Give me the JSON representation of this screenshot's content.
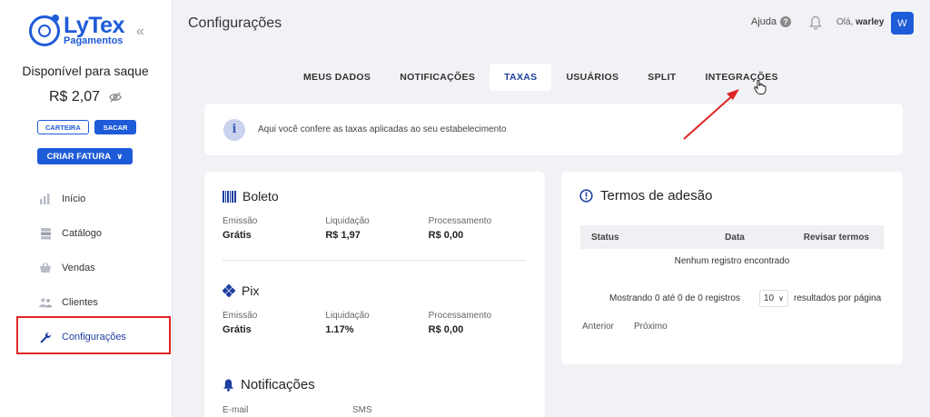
{
  "brand": {
    "name": "LyTex",
    "sub": "Pagamentos",
    "color": "#1e5bd8"
  },
  "sidebar": {
    "balance_label": "Disponível para saque",
    "balance_value": "R$ 2,07",
    "wallet_label": "CARTEIRA",
    "withdraw_label": "SACAR",
    "invoice_label": "CRIAR FATURA",
    "items": [
      {
        "label": "Início",
        "icon": "bar-chart-icon"
      },
      {
        "label": "Catálogo",
        "icon": "catalog-icon"
      },
      {
        "label": "Vendas",
        "icon": "basket-icon"
      },
      {
        "label": "Clientes",
        "icon": "users-icon"
      },
      {
        "label": "Configurações",
        "icon": "wrench-icon",
        "active": true
      }
    ]
  },
  "header": {
    "title": "Configurações",
    "help": "Ajuda",
    "greeting": "Olá,",
    "user": "warley",
    "avatar": "W"
  },
  "tabs": [
    {
      "label": "MEUS DADOS"
    },
    {
      "label": "NOTIFICAÇÕES"
    },
    {
      "label": "TAXAS",
      "active": true
    },
    {
      "label": "USUÁRIOS"
    },
    {
      "label": "SPLIT"
    },
    {
      "label": "INTEGRAÇÕES"
    }
  ],
  "info": {
    "text": "Aqui você confere as taxas aplicadas ao seu estabelecimento"
  },
  "fees": {
    "boleto": {
      "title": "Boleto",
      "cols": [
        {
          "label": "Emissão",
          "value": "Grátis"
        },
        {
          "label": "Liquidação",
          "value": "R$ 1,97"
        },
        {
          "label": "Processamento",
          "value": "R$ 0,00"
        }
      ]
    },
    "pix": {
      "title": "Pix",
      "cols": [
        {
          "label": "Emissão",
          "value": "Grátis"
        },
        {
          "label": "Liquidação",
          "value": "1.17%"
        },
        {
          "label": "Processamento",
          "value": "R$ 0,00"
        }
      ]
    },
    "notifications": {
      "title": "Notificações",
      "cols": [
        {
          "label": "E-mail"
        },
        {
          "label": "SMS"
        }
      ]
    }
  },
  "terms": {
    "title": "Termos de adesão",
    "columns": [
      "Status",
      "Data",
      "Revisar termos"
    ],
    "empty": "Nenhum registro encontrado",
    "showing": "Mostrando 0 até 0 de 0 registros",
    "page_size": "10",
    "per_page": "resultados por página",
    "prev": "Anterior",
    "next": "Próximo"
  },
  "annotation_color": "#e02424"
}
